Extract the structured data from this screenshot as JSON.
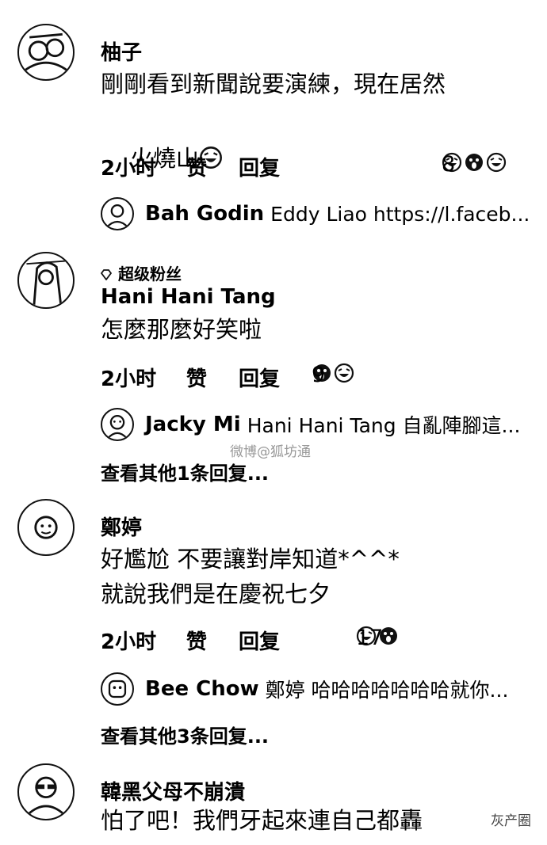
{
  "ui": {
    "like_label": "赞",
    "reply_label": "回复"
  },
  "comments": [
    {
      "name": "柚子",
      "text_lines": [
        "剛剛看到新聞說要演練，現在居然",
        "火燒山"
      ],
      "time": "2小时",
      "reaction_count": "8",
      "reaction_icons": [
        "laugh-emoji",
        "wow-emoji",
        "laugh-emoji"
      ],
      "reply": {
        "name": "Bah Godin",
        "text": "Eddy Liao https://l.faceb..."
      }
    },
    {
      "badge": "超级粉丝",
      "name": "Hani Hani Tang",
      "text_lines": [
        "怎麼那麼好笑啦"
      ],
      "time": "2小时",
      "reaction_count": "9",
      "reaction_icons": [
        "wow-emoji",
        "laugh-emoji"
      ],
      "reply": {
        "name": "Jacky Mi",
        "text": "Hani Hani Tang 自亂陣腳這..."
      },
      "more_replies": "查看其他1条回复..."
    },
    {
      "name": "鄭婷",
      "text_lines": [
        "好尷尬 不要讓對岸知道*^^*",
        "就說我們是在慶祝七夕"
      ],
      "time": "2小时",
      "reaction_count": "17",
      "reaction_icons": [
        "laugh-emoji",
        "wow-emoji"
      ],
      "reply": {
        "name": "Bee Chow",
        "text": "鄭婷 哈哈哈哈哈哈哈就你..."
      },
      "more_replies": "查看其他3条回复..."
    },
    {
      "name": "韓黑父母不崩潰",
      "text_lines": [
        "怕了吧！我們牙起來連自己都轟"
      ]
    }
  ],
  "watermarks": {
    "center": "微博@狐坊通",
    "corner": "灰产圈"
  }
}
